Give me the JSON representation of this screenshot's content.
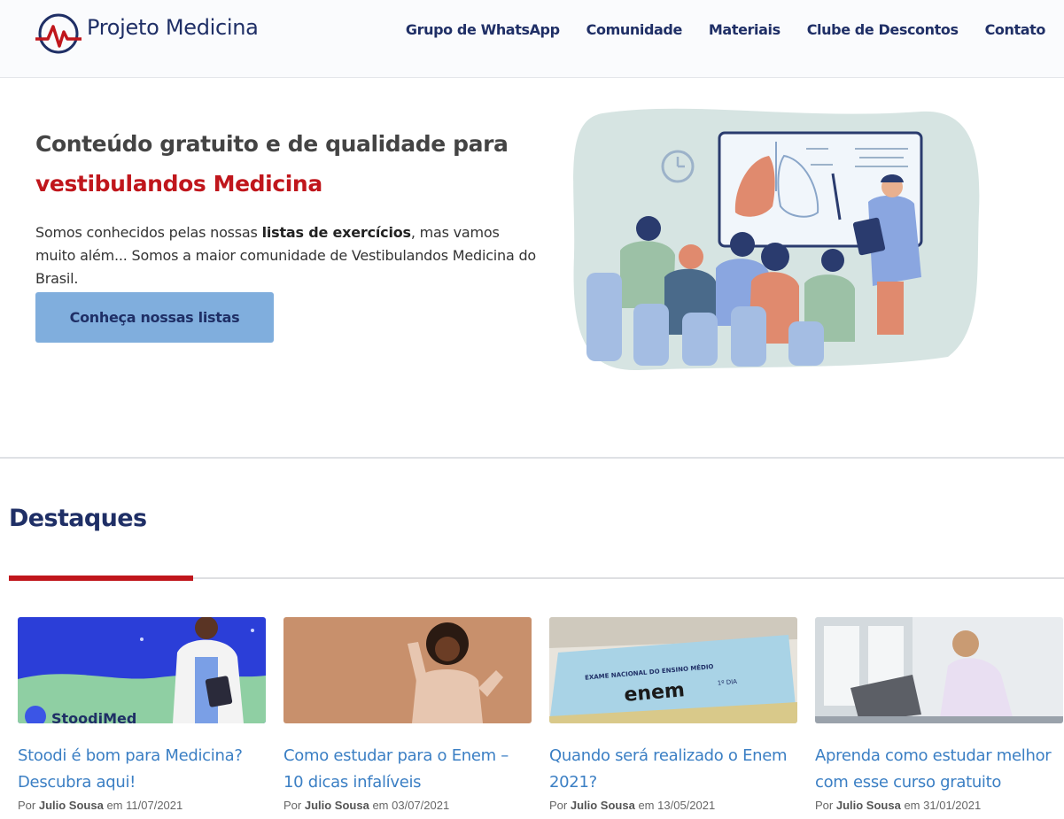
{
  "header": {
    "brand": "Projeto Medicina",
    "nav": [
      {
        "label": "Grupo de WhatsApp"
      },
      {
        "label": "Comunidade"
      },
      {
        "label": "Materiais"
      },
      {
        "label": "Clube de Descontos"
      },
      {
        "label": "Contato"
      }
    ]
  },
  "hero": {
    "title_part1": "Conteúdo ",
    "title_bold1": "gratuito",
    "title_part2": " e de ",
    "title_bold2": "qualidade",
    "title_part3": " para",
    "accent": "vestibulandos Medicina",
    "desc_part1": "Somos conhecidos pelas nossas ",
    "desc_bold": "listas de exercícios",
    "desc_part2": ", mas vamos muito além... Somos a maior comunidade de Vestibulandos Medicina do Brasil.",
    "cta": "Conheça nossas listas"
  },
  "destaques": {
    "title": "Destaques",
    "by": "Por",
    "on": "em",
    "cards": [
      {
        "title": "Stoodi é bom para Medicina? Descubra aqui!",
        "author": "Julio Sousa",
        "date": "11/07/2021",
        "image_text": "StoodiMed"
      },
      {
        "title": "Como estudar para o Enem – 10 dicas infalíveis",
        "author": "Julio Sousa",
        "date": "03/07/2021"
      },
      {
        "title": "Quando será realizado o Enem 2021?",
        "author": "Julio Sousa",
        "date": "13/05/2021",
        "image_text": "EXAME NACIONAL DO ENSINO MÉDIO",
        "image_logo": "enem",
        "image_day": "1º DIA"
      },
      {
        "title": "Aprenda como estudar melhor com esse curso gratuito",
        "author": "Julio Sousa",
        "date": "31/01/2021"
      }
    ]
  }
}
